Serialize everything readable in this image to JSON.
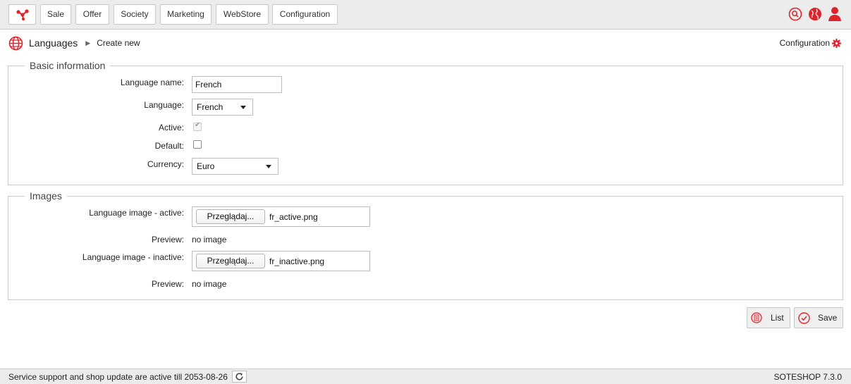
{
  "nav": {
    "logo_icon": "sote-logo-icon",
    "items": [
      "Sale",
      "Offer",
      "Society",
      "Marketing",
      "WebStore",
      "Configuration"
    ],
    "right_icons": [
      "search-icon",
      "globe-icon",
      "user-icon"
    ]
  },
  "breadcrumb": {
    "icon": "globe-icon",
    "title": "Languages",
    "current": "Create new"
  },
  "config_link": "Configuration",
  "basic": {
    "legend": "Basic information",
    "language_name_label": "Language name:",
    "language_name_value": "French",
    "language_label": "Language:",
    "language_value": "French",
    "active_label": "Active:",
    "active_checked": true,
    "default_label": "Default:",
    "default_checked": false,
    "currency_label": "Currency:",
    "currency_value": "Euro"
  },
  "images": {
    "legend": "Images",
    "active_label": "Language image - active:",
    "active_button": "Przeglądaj...",
    "active_file": "fr_active.png",
    "preview_label": "Preview:",
    "preview_active_value": "no image",
    "inactive_label": "Language image - inactive:",
    "inactive_button": "Przeglądaj...",
    "inactive_file": "fr_inactive.png",
    "preview_inactive_value": "no image"
  },
  "actions": {
    "list_label": "List",
    "save_label": "Save"
  },
  "footer": {
    "status": "Service support and shop update are active till 2053-08-26",
    "version": "SOTESHOP 7.3.0"
  },
  "colors": {
    "accent": "#e0232b",
    "topbar_bg": "#ececec",
    "border": "#c9c9c9"
  }
}
